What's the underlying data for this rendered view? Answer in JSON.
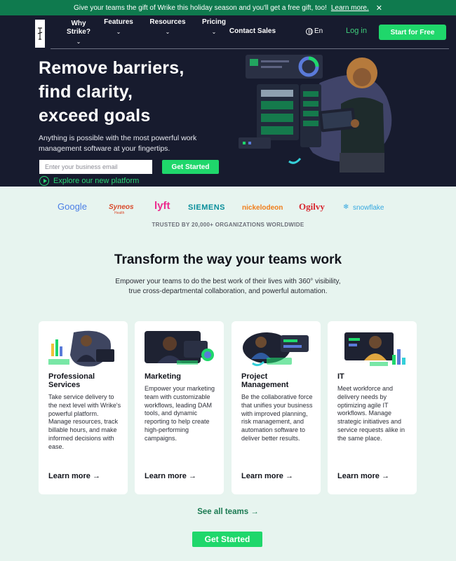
{
  "promo": {
    "text": "Give your teams the gift of Wrike this holiday season and you'll get a free gift, too!",
    "link": "Learn more.",
    "close": "✕"
  },
  "nav": {
    "why_line1": "Why",
    "why_line2": "Strike?",
    "features": "Features",
    "resources": "Resources",
    "pricing": "Pricing",
    "contact": "Contact Sales",
    "lang": "En",
    "login": "Log in",
    "cta": "Start for Free",
    "chevron": "⌄"
  },
  "hero": {
    "title": "Remove barriers,\nfind clarity,\nexceed goals",
    "subtitle": "Anything is possible with the most powerful work management software at your fingertips.",
    "email_placeholder": "Enter your business email",
    "cta": "Get Started",
    "explore": "Explore our new platform"
  },
  "logos": {
    "brands": [
      {
        "name": "Google",
        "color": "#4a7ee6"
      },
      {
        "name": "Syneos",
        "color": "#d94a2b"
      },
      {
        "name": "lyft",
        "color": "#ec2b8e"
      },
      {
        "name": "SIEMENS",
        "color": "#0a8e9b"
      },
      {
        "name": "nickelodeon",
        "color": "#f07d1a"
      },
      {
        "name": "Ogilvy",
        "color": "#d8262f"
      },
      {
        "name": "snowflake",
        "color": "#35a8e0"
      }
    ],
    "syneos_sub": "Health",
    "trusted": "TRUSTED BY 20,000+ ORGANIZATIONS WORLDWIDE"
  },
  "section": {
    "title": "Transform the way your teams work",
    "subtitle": "Empower your teams to do the best work of their lives with 360° visibility, true cross-departmental collaboration, and powerful automation."
  },
  "cards": [
    {
      "title": "Professional Services",
      "desc": "Take service delivery to the next level with Wrike's powerful platform. Manage resources, track billable hours, and make informed decisions with ease.",
      "learn": "Learn more →"
    },
    {
      "title": "Marketing",
      "desc": "Empower your marketing team with customizable workflows, leading DAM tools, and dynamic reporting to help create high-performing campaigns.",
      "learn": "Learn more →"
    },
    {
      "title": "Project Management",
      "desc": "Be the collaborative force that unifies your business with improved planning, risk management, and automation software to deliver better results.",
      "learn": "Learn more →"
    },
    {
      "title": "IT",
      "desc": "Meet workforce and delivery needs by optimizing agile IT workflows. Manage strategic initiatives and service requests alike in the same place.",
      "learn": "Learn more →"
    }
  ],
  "footer": {
    "see_all": "See all teams →",
    "cta": "Get Started"
  },
  "colors": {
    "brand_green": "#1fd76b",
    "dark_navy": "#171b2e",
    "promo_green": "#0f7a4e",
    "page_bg": "#e7f4ef"
  }
}
